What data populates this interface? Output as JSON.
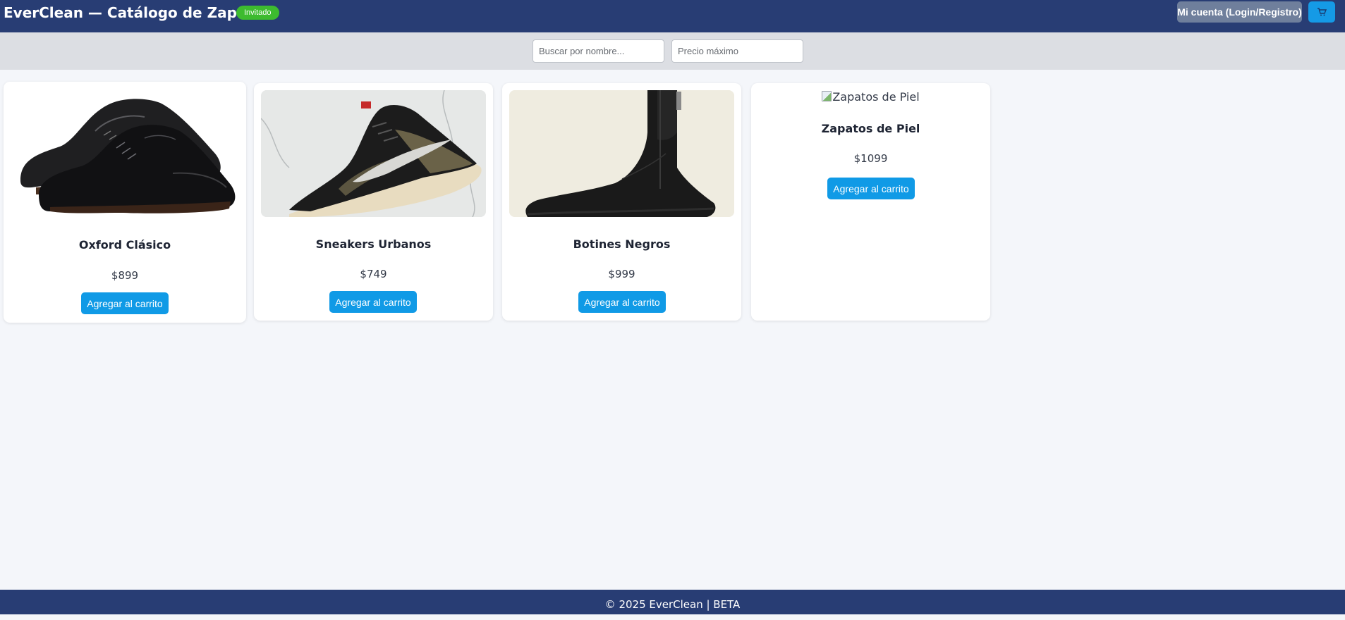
{
  "header": {
    "title": "EverClean — Catálogo de Zapatos",
    "user_badge": "Invitado",
    "account_button": "Mi cuenta (Login/Registro)",
    "cart_icon": "cart-icon"
  },
  "filters": {
    "search_placeholder": "Buscar por nombre...",
    "price_placeholder": "Precio máximo"
  },
  "products": [
    {
      "name": "Oxford Clásico",
      "price": "$899",
      "button": "Agregar al carrito",
      "image": "black-oxford-shoes"
    },
    {
      "name": "Sneakers Urbanos",
      "price": "$749",
      "button": "Agregar al carrito",
      "image": "olive-black-sneaker"
    },
    {
      "name": "Botines Negros",
      "price": "$999",
      "button": "Agregar al carrito",
      "image": "black-leather-boot"
    },
    {
      "name": "Zapatos de Piel",
      "price": "$1099",
      "button": "Agregar al carrito",
      "image_alt": "Zapatos de Piel"
    }
  ],
  "footer": {
    "text": "© 2025 EverClean | BETA"
  },
  "colors": {
    "header_bg": "#283d74",
    "accent": "#109ae6",
    "badge": "#3dbb2f",
    "account_button": "#6f7f9c"
  }
}
